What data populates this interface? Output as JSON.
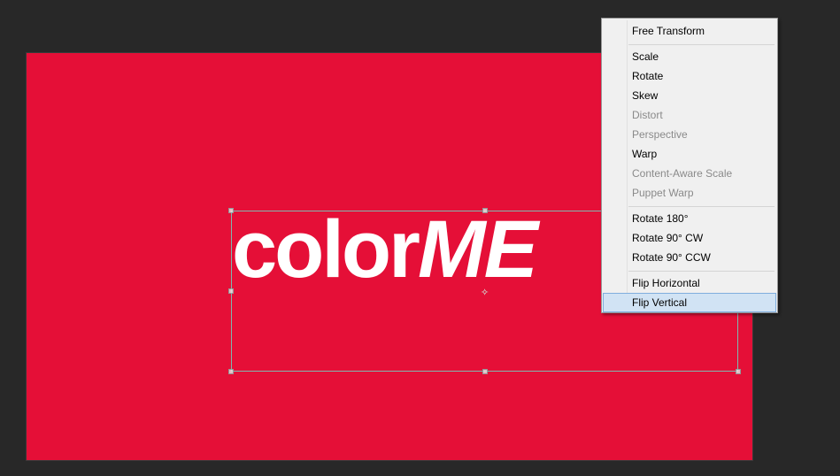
{
  "canvas": {
    "background_color": "#e50f37",
    "logo_part1": "color",
    "logo_part2": "ME"
  },
  "menu": {
    "groups": [
      [
        {
          "label": "Free Transform",
          "enabled": true
        }
      ],
      [
        {
          "label": "Scale",
          "enabled": true
        },
        {
          "label": "Rotate",
          "enabled": true
        },
        {
          "label": "Skew",
          "enabled": true
        },
        {
          "label": "Distort",
          "enabled": false
        },
        {
          "label": "Perspective",
          "enabled": false
        },
        {
          "label": "Warp",
          "enabled": true
        },
        {
          "label": "Content-Aware Scale",
          "enabled": false
        },
        {
          "label": "Puppet Warp",
          "enabled": false
        }
      ],
      [
        {
          "label": "Rotate 180°",
          "enabled": true
        },
        {
          "label": "Rotate 90° CW",
          "enabled": true
        },
        {
          "label": "Rotate 90° CCW",
          "enabled": true
        }
      ],
      [
        {
          "label": "Flip Horizontal",
          "enabled": true
        },
        {
          "label": "Flip Vertical",
          "enabled": true,
          "highlighted": true
        }
      ]
    ]
  }
}
